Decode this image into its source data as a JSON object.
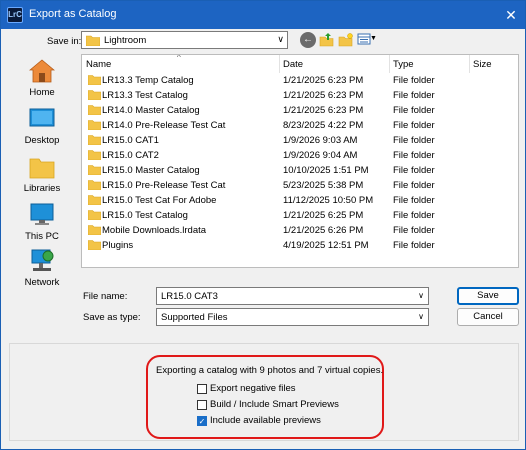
{
  "window": {
    "title": "Export as Catalog",
    "app_icon": "LrC",
    "close_glyph": "✕"
  },
  "save_in": {
    "label": "Save in:",
    "value": "Lightroom"
  },
  "places": [
    {
      "label": "Home",
      "icon": "home-icon"
    },
    {
      "label": "Desktop",
      "icon": "desktop-icon"
    },
    {
      "label": "Libraries",
      "icon": "libraries-icon"
    },
    {
      "label": "This PC",
      "icon": "this-pc-icon"
    },
    {
      "label": "Network",
      "icon": "network-icon"
    }
  ],
  "columns": {
    "name": "Name",
    "date": "Date",
    "type": "Type",
    "size": "Size"
  },
  "files": [
    {
      "name": "LR13.3 Temp Catalog",
      "date": "1/21/2025 6:23 PM",
      "type": "File folder"
    },
    {
      "name": "LR13.3 Test Catalog",
      "date": "1/21/2025 6:23 PM",
      "type": "File folder"
    },
    {
      "name": "LR14.0 Master Catalog",
      "date": "1/21/2025 6:23 PM",
      "type": "File folder"
    },
    {
      "name": "LR14.0 Pre-Release Test Cat",
      "date": "8/23/2025 4:22 PM",
      "type": "File folder"
    },
    {
      "name": "LR15.0 CAT1",
      "date": "1/9/2026 9:03 AM",
      "type": "File folder"
    },
    {
      "name": "LR15.0 CAT2",
      "date": "1/9/2026 9:04 AM",
      "type": "File folder"
    },
    {
      "name": "LR15.0 Master Catalog",
      "date": "10/10/2025 1:51 PM",
      "type": "File folder"
    },
    {
      "name": "LR15.0 Pre-Release Test Cat",
      "date": "5/23/2025 5:38 PM",
      "type": "File folder"
    },
    {
      "name": "LR15.0 Test Cat For Adobe",
      "date": "11/12/2025 10:50 PM",
      "type": "File folder"
    },
    {
      "name": "LR15.0 Test Catalog",
      "date": "1/21/2025 6:25 PM",
      "type": "File folder"
    },
    {
      "name": "Mobile Downloads.lrdata",
      "date": "1/21/2025 6:26 PM",
      "type": "File folder"
    },
    {
      "name": "Plugins",
      "date": "4/19/2025 12:51 PM",
      "type": "File folder"
    }
  ],
  "file_name": {
    "label": "File name:",
    "value": "LR15.0 CAT3"
  },
  "save_as_type": {
    "label": "Save as type:",
    "value": "Supported Files"
  },
  "buttons": {
    "save": "Save",
    "cancel": "Cancel"
  },
  "export": {
    "message": "Exporting a catalog with 9 photos and 7 virtual copies.",
    "options": [
      {
        "label": "Export negative files",
        "checked": false
      },
      {
        "label": "Build / Include Smart Previews",
        "checked": false
      },
      {
        "label": "Include available previews",
        "checked": true
      }
    ]
  },
  "colors": {
    "titlebar": "#1d64c2",
    "folder": "#f3c447",
    "highlight": "#e01818",
    "checkbox_on": "#1a6ec8"
  }
}
